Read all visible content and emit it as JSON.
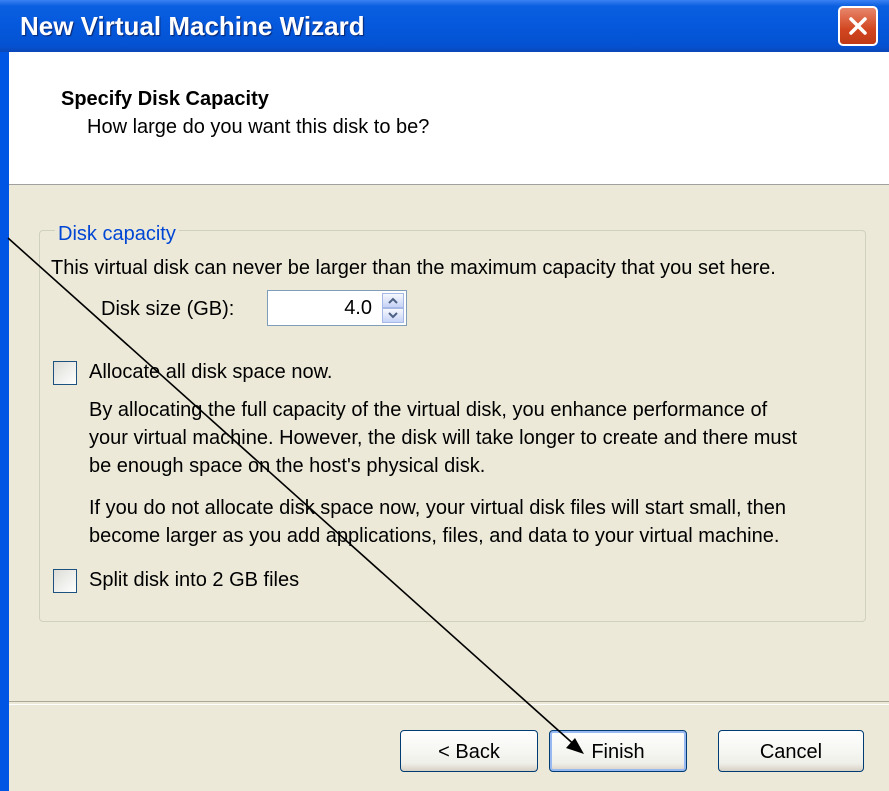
{
  "window": {
    "title": "New Virtual Machine Wizard",
    "close_icon": "close-icon"
  },
  "header": {
    "title": "Specify Disk Capacity",
    "subtitle": "How large do you want this disk to be?"
  },
  "group": {
    "legend": "Disk capacity",
    "description": "This virtual disk can never be larger than the maximum capacity that you set here.",
    "disk_size_label": "Disk size (GB):",
    "disk_size_value": "4.0",
    "allocate": {
      "label": "Allocate all disk space now.",
      "checked": false,
      "para1_line1": "By allocating the full capacity of the virtual disk, you enhance performance of",
      "para1_line2": "your virtual machine.  However, the disk will take longer to create and there must",
      "para1_line3": "be enough space on the host's physical disk.",
      "para2_line1": "If you do not allocate disk space now, your virtual disk files will start small, then",
      "para2_line2": "become larger as you add applications, files, and data to your virtual machine."
    },
    "split": {
      "label": "Split disk into 2 GB files",
      "checked": false
    }
  },
  "buttons": {
    "back": "< Back",
    "finish": "Finish",
    "cancel": "Cancel"
  },
  "colors": {
    "titlebar": "#0558dc",
    "legend": "#0046d5",
    "dialog_bg": "#ece9d8"
  }
}
